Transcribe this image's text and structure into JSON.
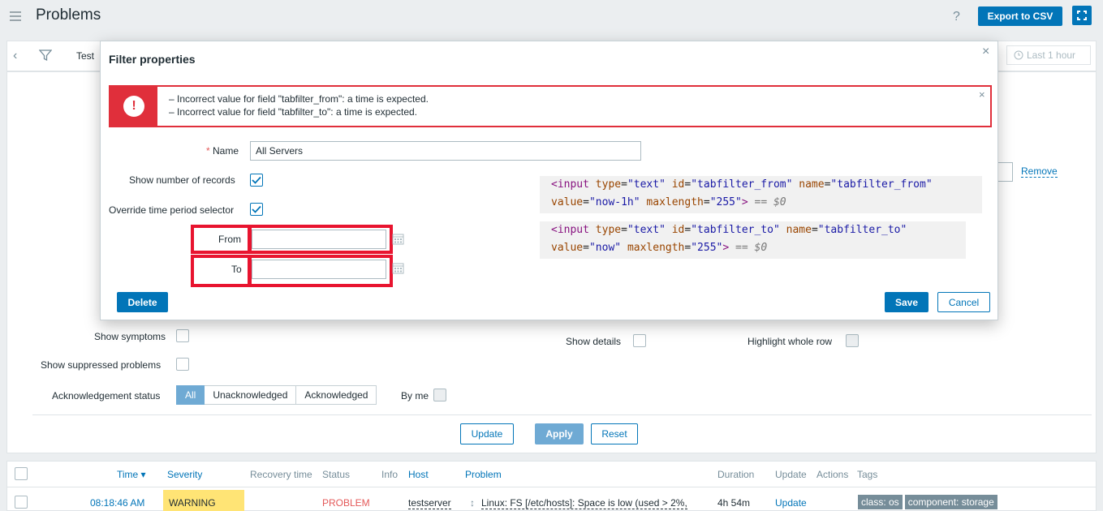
{
  "header": {
    "title": "Problems",
    "help": "?",
    "export_label": "Export to CSV"
  },
  "filter_bar": {
    "tab_label": "Test",
    "time_label": "Last 1 hour",
    "remove_label": "Remove"
  },
  "filter_panel": {
    "show_symptoms": "Show symptoms",
    "show_suppressed": "Show suppressed problems",
    "ack_status_label": "Acknowledgement status",
    "ack_options": [
      "All",
      "Unacknowledged",
      "Acknowledged"
    ],
    "by_me": "By me",
    "show_details": "Show details",
    "highlight_row": "Highlight whole row",
    "update_label": "Update",
    "apply_label": "Apply",
    "reset_label": "Reset"
  },
  "modal": {
    "title": "Filter properties",
    "errors": [
      "– Incorrect value for field \"tabfilter_from\": a time is expected.",
      "– Incorrect value for field \"tabfilter_to\": a time is expected."
    ],
    "name_label": "Name",
    "name_value": "All Servers",
    "show_records_label": "Show number of records",
    "override_label": "Override time period selector",
    "from_label": "From",
    "to_label": "To",
    "from_value": "",
    "to_value": "",
    "delete_label": "Delete",
    "save_label": "Save",
    "cancel_label": "Cancel",
    "code1": {
      "tag_open": "<input",
      "a1": "type",
      "v1": "\"text\"",
      "a2": "id",
      "v2": "\"tabfilter_from\"",
      "a3": "name",
      "v3": "\"tabfilter_from\"",
      "a4": "value",
      "v4": "\"now-1h\"",
      "a5": "maxlength",
      "v5": "\"255\"",
      "tag_close": ">",
      "dollar": "== $0"
    },
    "code2": {
      "tag_open": "<input",
      "a1": "type",
      "v1": "\"text\"",
      "a2": "id",
      "v2": "\"tabfilter_to\"",
      "a3": "name",
      "v3": "\"tabfilter_to\"",
      "a4": "value",
      "v4": "\"now\"",
      "a5": "maxlength",
      "v5": "\"255\"",
      "tag_close": ">",
      "dollar": "== $0"
    }
  },
  "table": {
    "headers": [
      "Time ▾",
      "Severity",
      "Recovery time",
      "Status",
      "Info",
      "Host",
      "Problem",
      "Duration",
      "Update",
      "Actions",
      "Tags"
    ],
    "row": {
      "time": "08:18:46 AM",
      "severity": "WARNING",
      "status": "PROBLEM",
      "host": "testserver",
      "problem": "Linux: FS [/etc/hosts]: Space is low (used > 2%,",
      "duration": "4h 54m",
      "update": "Update",
      "tags": [
        "class: os",
        "component: storage"
      ]
    }
  },
  "colors": {
    "accent": "#0275b8",
    "error_red": "#e02f3b",
    "warning_yellow": "#ffe475",
    "problem_red": "#e45959",
    "highlight_box": "#e8142f"
  }
}
